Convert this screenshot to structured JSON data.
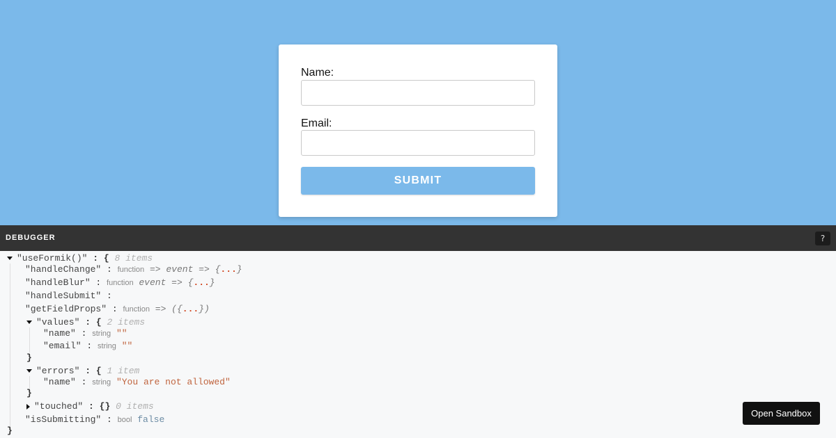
{
  "form": {
    "name_label": "Name:",
    "email_label": "Email:",
    "name_value": "",
    "email_value": "",
    "submit_label": "SUBMIT"
  },
  "debugger": {
    "title": "DEBUGGER",
    "icon": "?",
    "root_key": "\"useFormik()\"",
    "root_meta": "8 items",
    "handle_change_key": "\"handleChange\"",
    "handle_change_fn": "=> event => {",
    "handle_blur_key": "\"handleBlur\"",
    "handle_blur_fn": "event => {",
    "handle_submit_key": "\"handleSubmit\"",
    "get_field_props_key": "\"getFieldProps\"",
    "get_field_props_fn": "=> ({",
    "function_type": "function",
    "string_type": "string",
    "bool_type": "bool",
    "ellipsis": "...",
    "values_key": "\"values\"",
    "values_meta": "2 items",
    "values_name_key": "\"name\"",
    "values_name_value": "\"\"",
    "values_email_key": "\"email\"",
    "values_email_value": "\"\"",
    "errors_key": "\"errors\"",
    "errors_meta": "1 item",
    "errors_name_key": "\"name\"",
    "errors_name_value": "\"You are not allowed\"",
    "touched_key": "\"touched\"",
    "touched_meta": "0 items",
    "is_submitting_key": "\"isSubmitting\"",
    "is_submitting_value": "false"
  },
  "sandbox_label": "Open Sandbox"
}
